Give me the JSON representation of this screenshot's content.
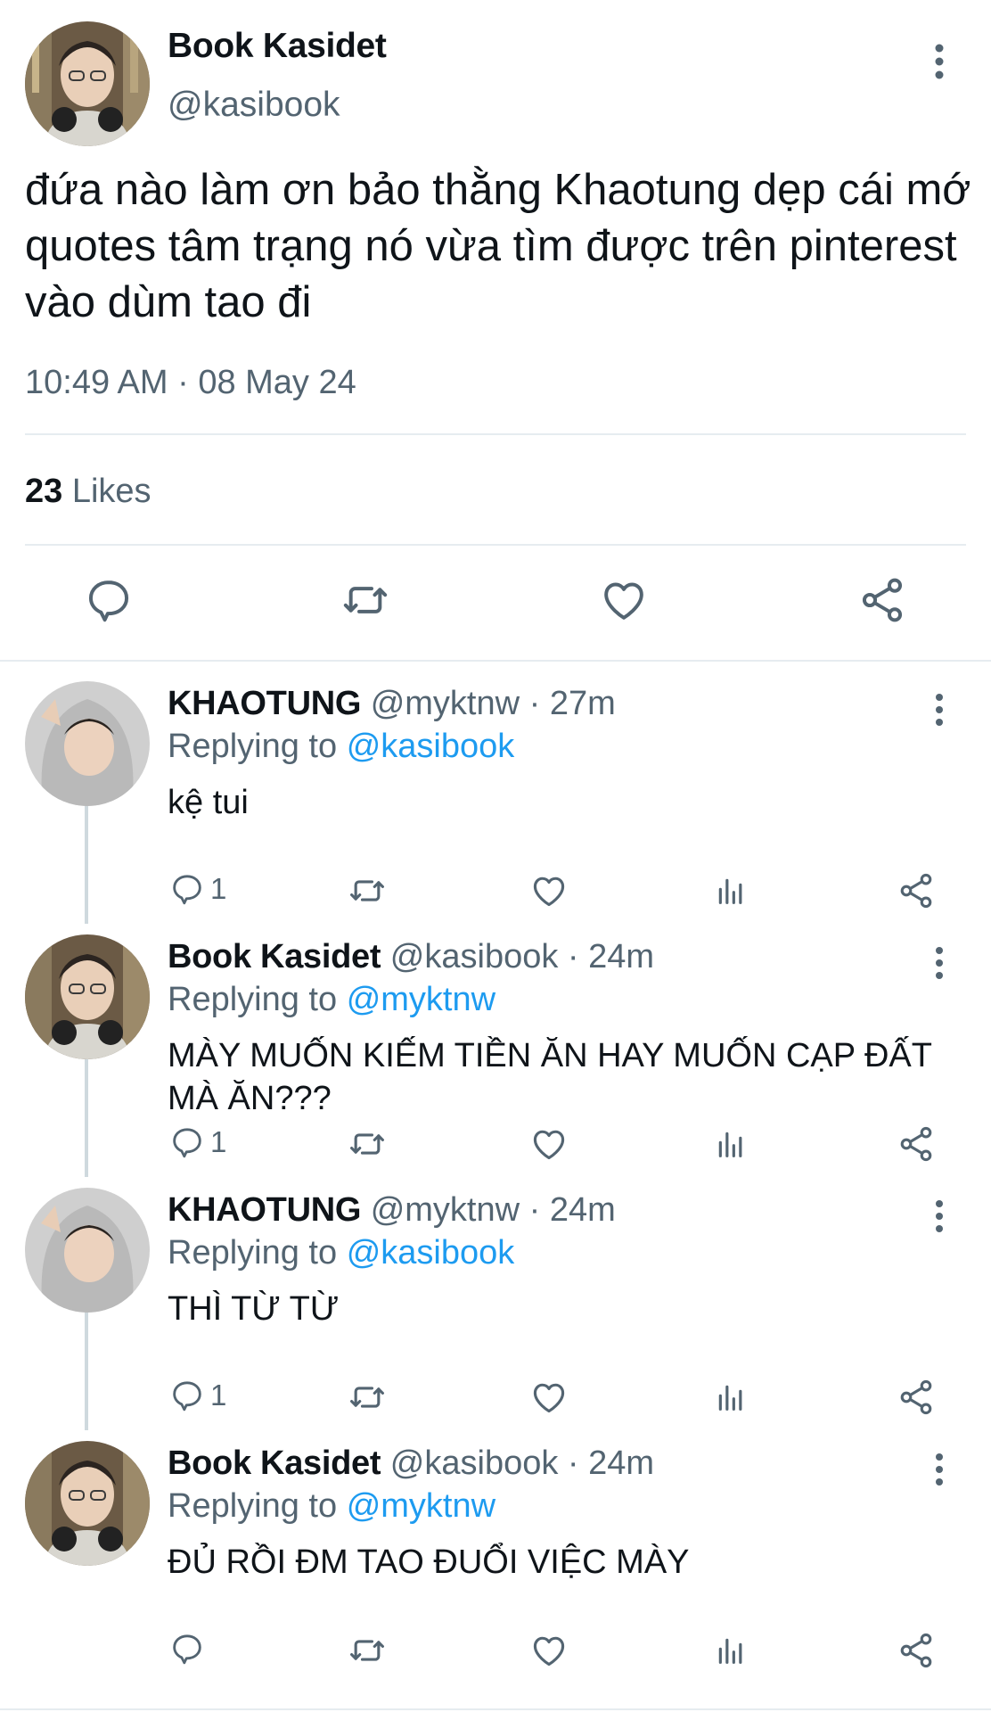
{
  "main_tweet": {
    "name": "Book Kasidet",
    "handle": "@kasibook",
    "text": "đứa nào làm ơn bảo thằng Khaotung dẹp cái mớ quotes tâm trạng nó vừa tìm được trên pinterest vào dùm tao đi",
    "timestamp": "10:49 AM · 08 May 24",
    "likes_count": "23",
    "likes_label": "Likes",
    "actions": [
      "reply-icon",
      "retweet-icon",
      "like-icon",
      "share-icon"
    ]
  },
  "replies": [
    {
      "name": "KHAOTUNG",
      "meta": "@myktnw · 27m",
      "replying_prefix": "Replying to",
      "replying_to": "@kasibook",
      "text": "kệ tui",
      "reply_count": "1"
    },
    {
      "name": "Book Kasidet",
      "meta": "@kasibook · 24m",
      "replying_prefix": "Replying to",
      "replying_to": "@myktnw",
      "text": "MÀY MUỐN KIẾM TIỀN ĂN HAY MUỐN CẠP ĐẤT MÀ ĂN???",
      "reply_count": "1"
    },
    {
      "name": "KHAOTUNG",
      "meta": "@myktnw · 24m",
      "replying_prefix": "Replying to",
      "replying_to": "@kasibook",
      "text": "THÌ TỪ TỪ",
      "reply_count": "1"
    },
    {
      "name": "Book Kasidet",
      "meta": "@kasibook · 24m",
      "replying_prefix": "Replying to",
      "replying_to": "@myktnw",
      "text": "ĐỦ RỒI ĐM TAO ĐUỔI VIỆC MÀY",
      "reply_count": ""
    }
  ],
  "colors": {
    "accent": "#1d9bf0",
    "secondary_text": "#536471",
    "divider": "#e6ecf0"
  }
}
